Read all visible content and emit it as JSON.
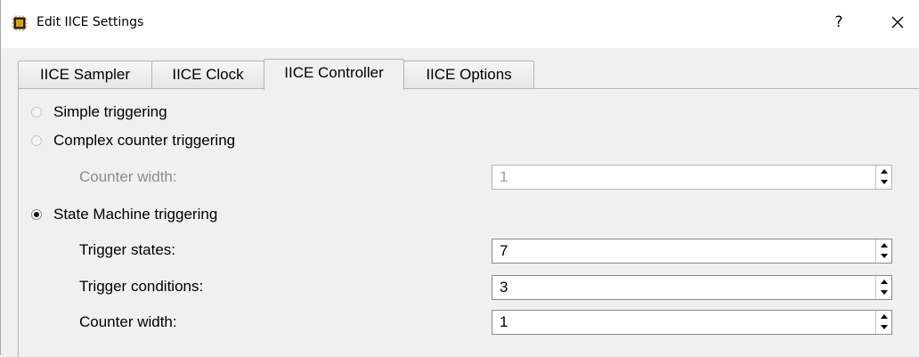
{
  "window": {
    "title": "Edit IICE Settings",
    "help_label": "?"
  },
  "tabs": [
    {
      "label": "IICE Sampler",
      "active": false
    },
    {
      "label": "IICE Clock",
      "active": false
    },
    {
      "label": "IICE Controller",
      "active": true
    },
    {
      "label": "IICE Options",
      "active": false
    }
  ],
  "controller": {
    "simple": {
      "label": "Simple triggering",
      "checked": false
    },
    "complex": {
      "label": "Complex counter triggering",
      "checked": false,
      "counter_width": {
        "label": "Counter width:",
        "value": "1",
        "enabled": false
      }
    },
    "state_machine": {
      "label": "State Machine triggering",
      "checked": true,
      "trigger_states": {
        "label": "Trigger states:",
        "value": "7"
      },
      "trigger_conditions": {
        "label": "Trigger conditions:",
        "value": "3"
      },
      "counter_width": {
        "label": "Counter width:",
        "value": "1"
      }
    }
  },
  "icons": {
    "app": "chip-icon",
    "close": "close-icon"
  }
}
